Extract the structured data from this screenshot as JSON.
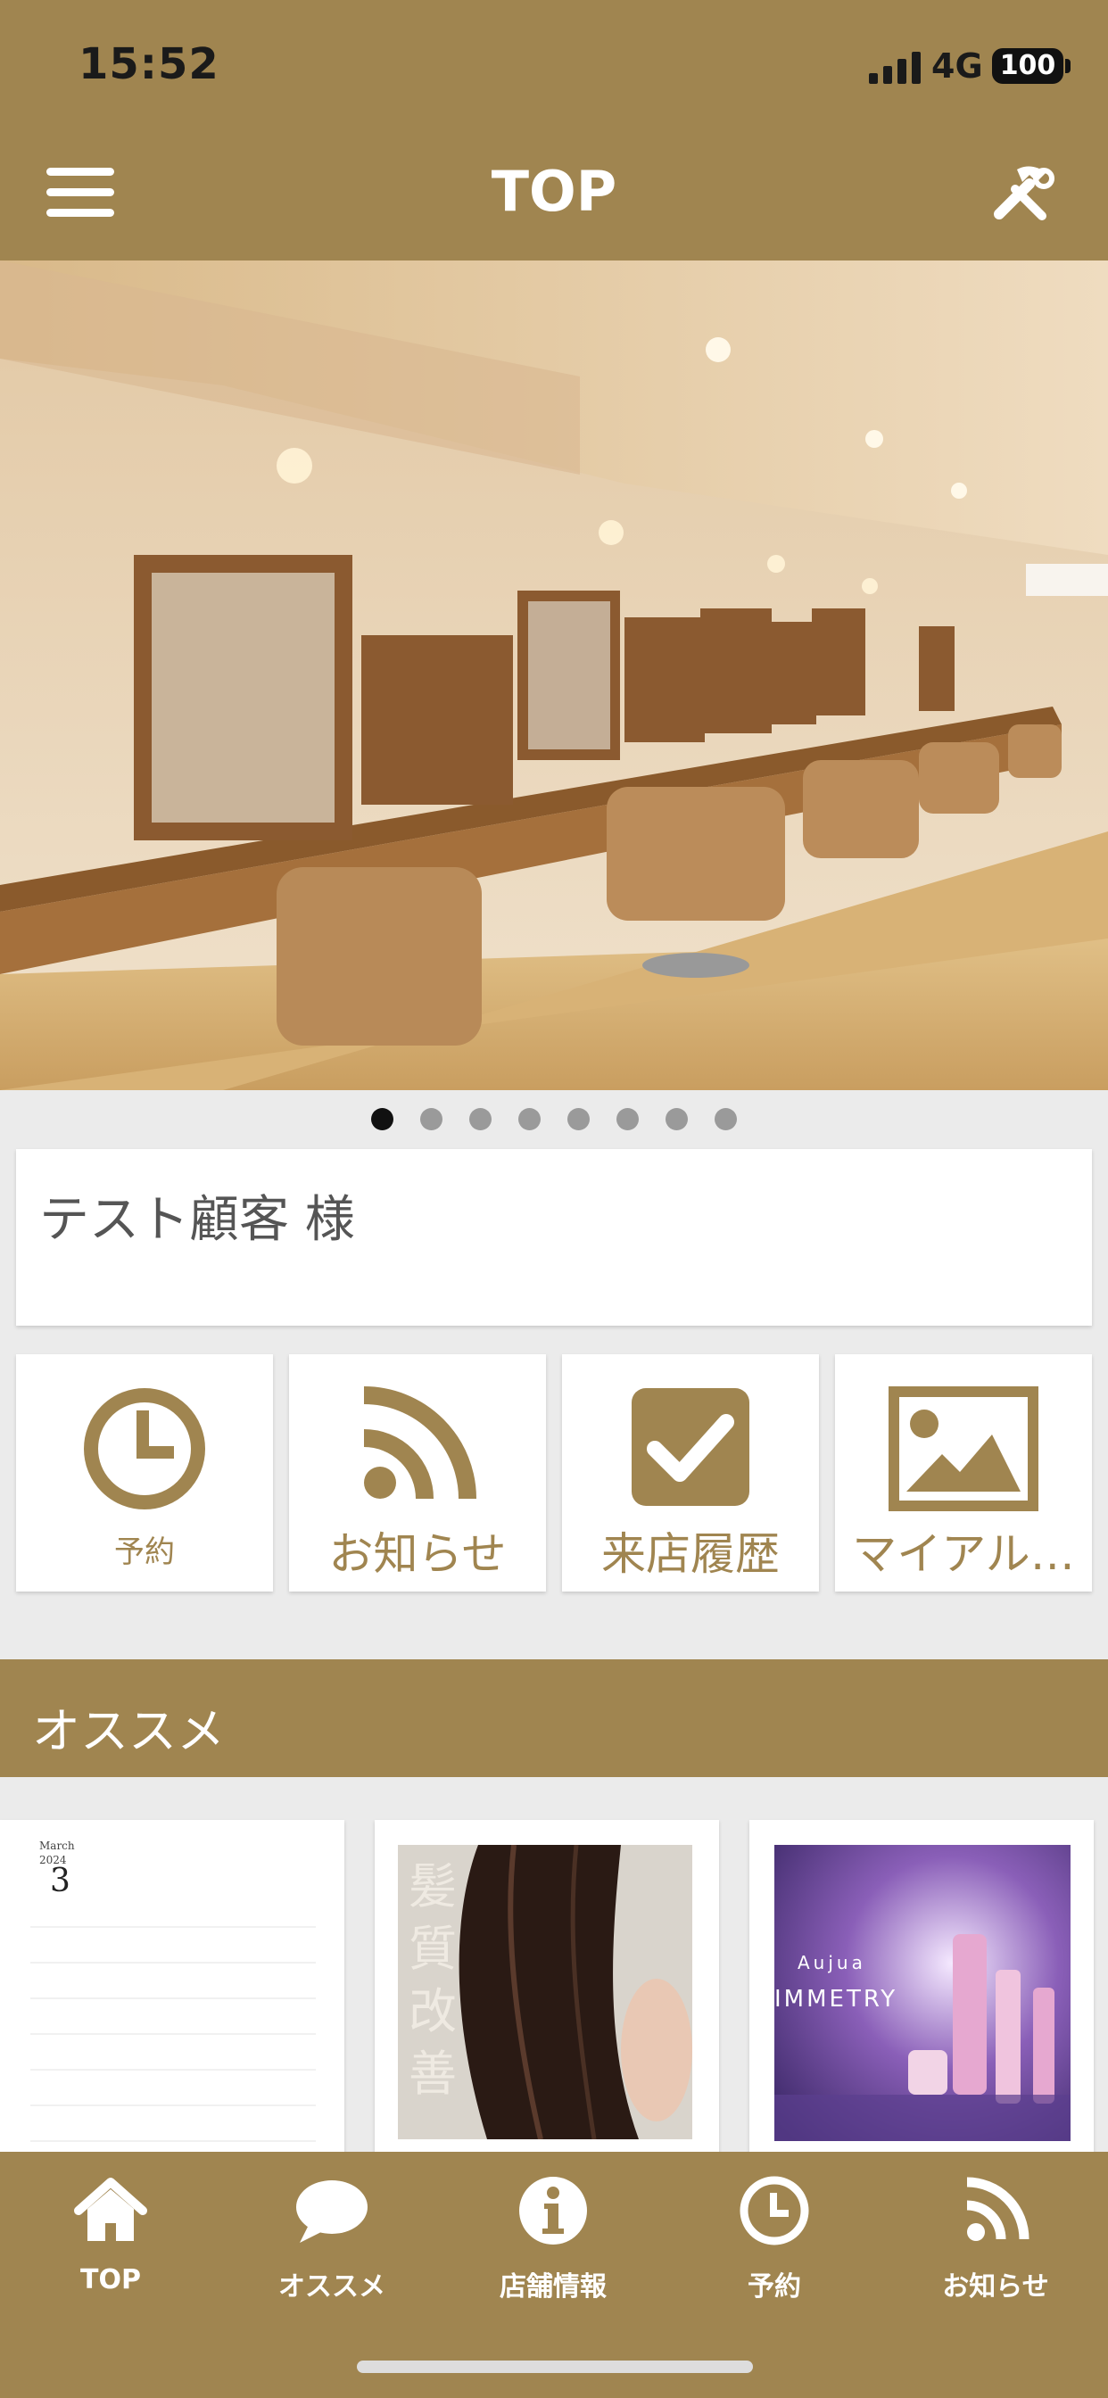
{
  "status_bar": {
    "time": "15:52",
    "network": "4G",
    "battery": "100"
  },
  "header": {
    "title": "TOP",
    "menu_icon": "hamburger-icon",
    "tools_icon": "tools-icon"
  },
  "hero": {
    "image": "salon-interior-photo",
    "slide_count": 8,
    "active_slide": 1
  },
  "customer": {
    "name": "テスト顧客 様"
  },
  "tiles": [
    {
      "label": "予約",
      "icon": "clock-icon"
    },
    {
      "label": "お知らせ",
      "icon": "rss-icon"
    },
    {
      "label": "来店履歴",
      "icon": "checkbox-icon"
    },
    {
      "label": "マイアル…",
      "icon": "image-icon"
    }
  ],
  "recommend": {
    "title": "オススメ",
    "cards": [
      {
        "image": "calendar-image",
        "calendar_month": "3",
        "calendar_caption": "March",
        "calendar_year": "2024"
      },
      {
        "image": "hair-photo",
        "overlay_text": "髪質改善"
      },
      {
        "image": "product-photo",
        "brand_text": "Aujua",
        "product_text": "IMMETRY"
      }
    ]
  },
  "bottom_nav": [
    {
      "label": "TOP",
      "icon": "home-icon"
    },
    {
      "label": "オススメ",
      "icon": "chat-bubble-icon"
    },
    {
      "label": "店舗情報",
      "icon": "info-icon"
    },
    {
      "label": "予約",
      "icon": "clock-icon"
    },
    {
      "label": "お知らせ",
      "icon": "rss-icon"
    }
  ],
  "colors": {
    "brand": "#a08550",
    "background": "#ebebeb"
  }
}
